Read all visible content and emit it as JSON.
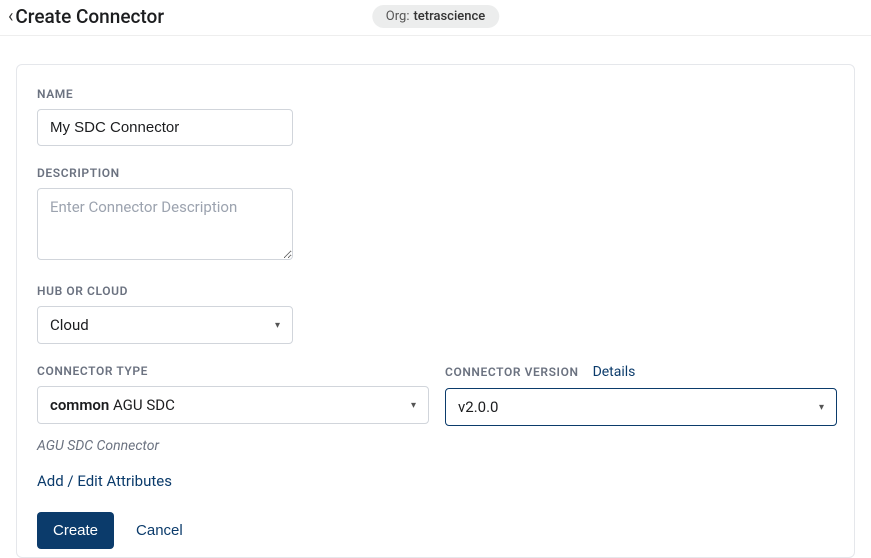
{
  "header": {
    "title": "Create Connector",
    "org_prefix": "Org:",
    "org_name": "tetrascience"
  },
  "form": {
    "name_label": "NAME",
    "name_value": "My SDC Connector",
    "description_label": "DESCRIPTION",
    "description_placeholder": "Enter Connector Description",
    "hub_label": "HUB OR CLOUD",
    "hub_value": "Cloud",
    "type_label": "CONNECTOR TYPE",
    "type_bold": "common",
    "type_rest": " AGU SDC",
    "type_desc": "AGU SDC Connector",
    "version_label": "CONNECTOR VERSION",
    "version_details": "Details",
    "version_value": "v2.0.0",
    "attributes_link": "Add / Edit Attributes",
    "create_btn": "Create",
    "cancel_btn": "Cancel"
  }
}
